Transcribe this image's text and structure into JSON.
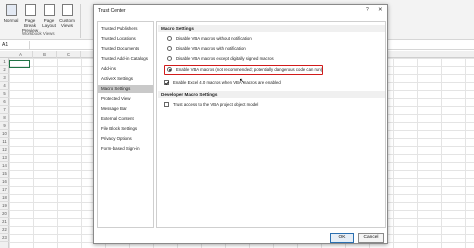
{
  "excel": {
    "ribbon_buttons": [
      {
        "label": "Normal",
        "label2": ""
      },
      {
        "label": "Page Break",
        "label2": "Preview"
      },
      {
        "label": "Page",
        "label2": "Layout"
      },
      {
        "label": "Custom",
        "label2": "Views"
      }
    ],
    "ribbon_group": "Workbook Views",
    "name_box": "A1",
    "columns": [
      "A",
      "B",
      "C"
    ],
    "rows": [
      "1",
      "2",
      "3",
      "4",
      "5",
      "6",
      "7",
      "8",
      "9",
      "10",
      "11",
      "12",
      "13",
      "14",
      "15",
      "16",
      "17",
      "18",
      "19",
      "20",
      "21",
      "22",
      "23"
    ]
  },
  "dialog": {
    "title": "Trust Center",
    "help": "?",
    "close": "✕",
    "nav": [
      "Trusted Publishers",
      "Trusted Locations",
      "Trusted Documents",
      "Trusted Add-in Catalogs",
      "Add-ins",
      "ActiveX Settings",
      "Macro Settings",
      "Protected View",
      "Message Bar",
      "External Content",
      "File Block Settings",
      "Privacy Options",
      "Form-based Sign-in"
    ],
    "active_nav_index": 6,
    "macro_section_title": "Macro Settings",
    "macro_options": [
      "Disable VBA macros without notification",
      "Disable VBA macros with notification",
      "Disable VBA macros except digitally signed macros",
      "Enable VBA macros (not recommended; potentially dangerous code can run)"
    ],
    "selected_option_index": 3,
    "excel4_checkbox": "Enable Excel 4.0 macros when VBA macros are enabled",
    "dev_section_title": "Developer Macro Settings",
    "vba_access_checkbox": "Trust access to the VBA project object model",
    "ok_label": "OK",
    "cancel_label": "Cancel"
  },
  "colors": {
    "highlight": "#d11a1a",
    "active_nav": "#c9c9c9",
    "excel_green": "#217346"
  }
}
